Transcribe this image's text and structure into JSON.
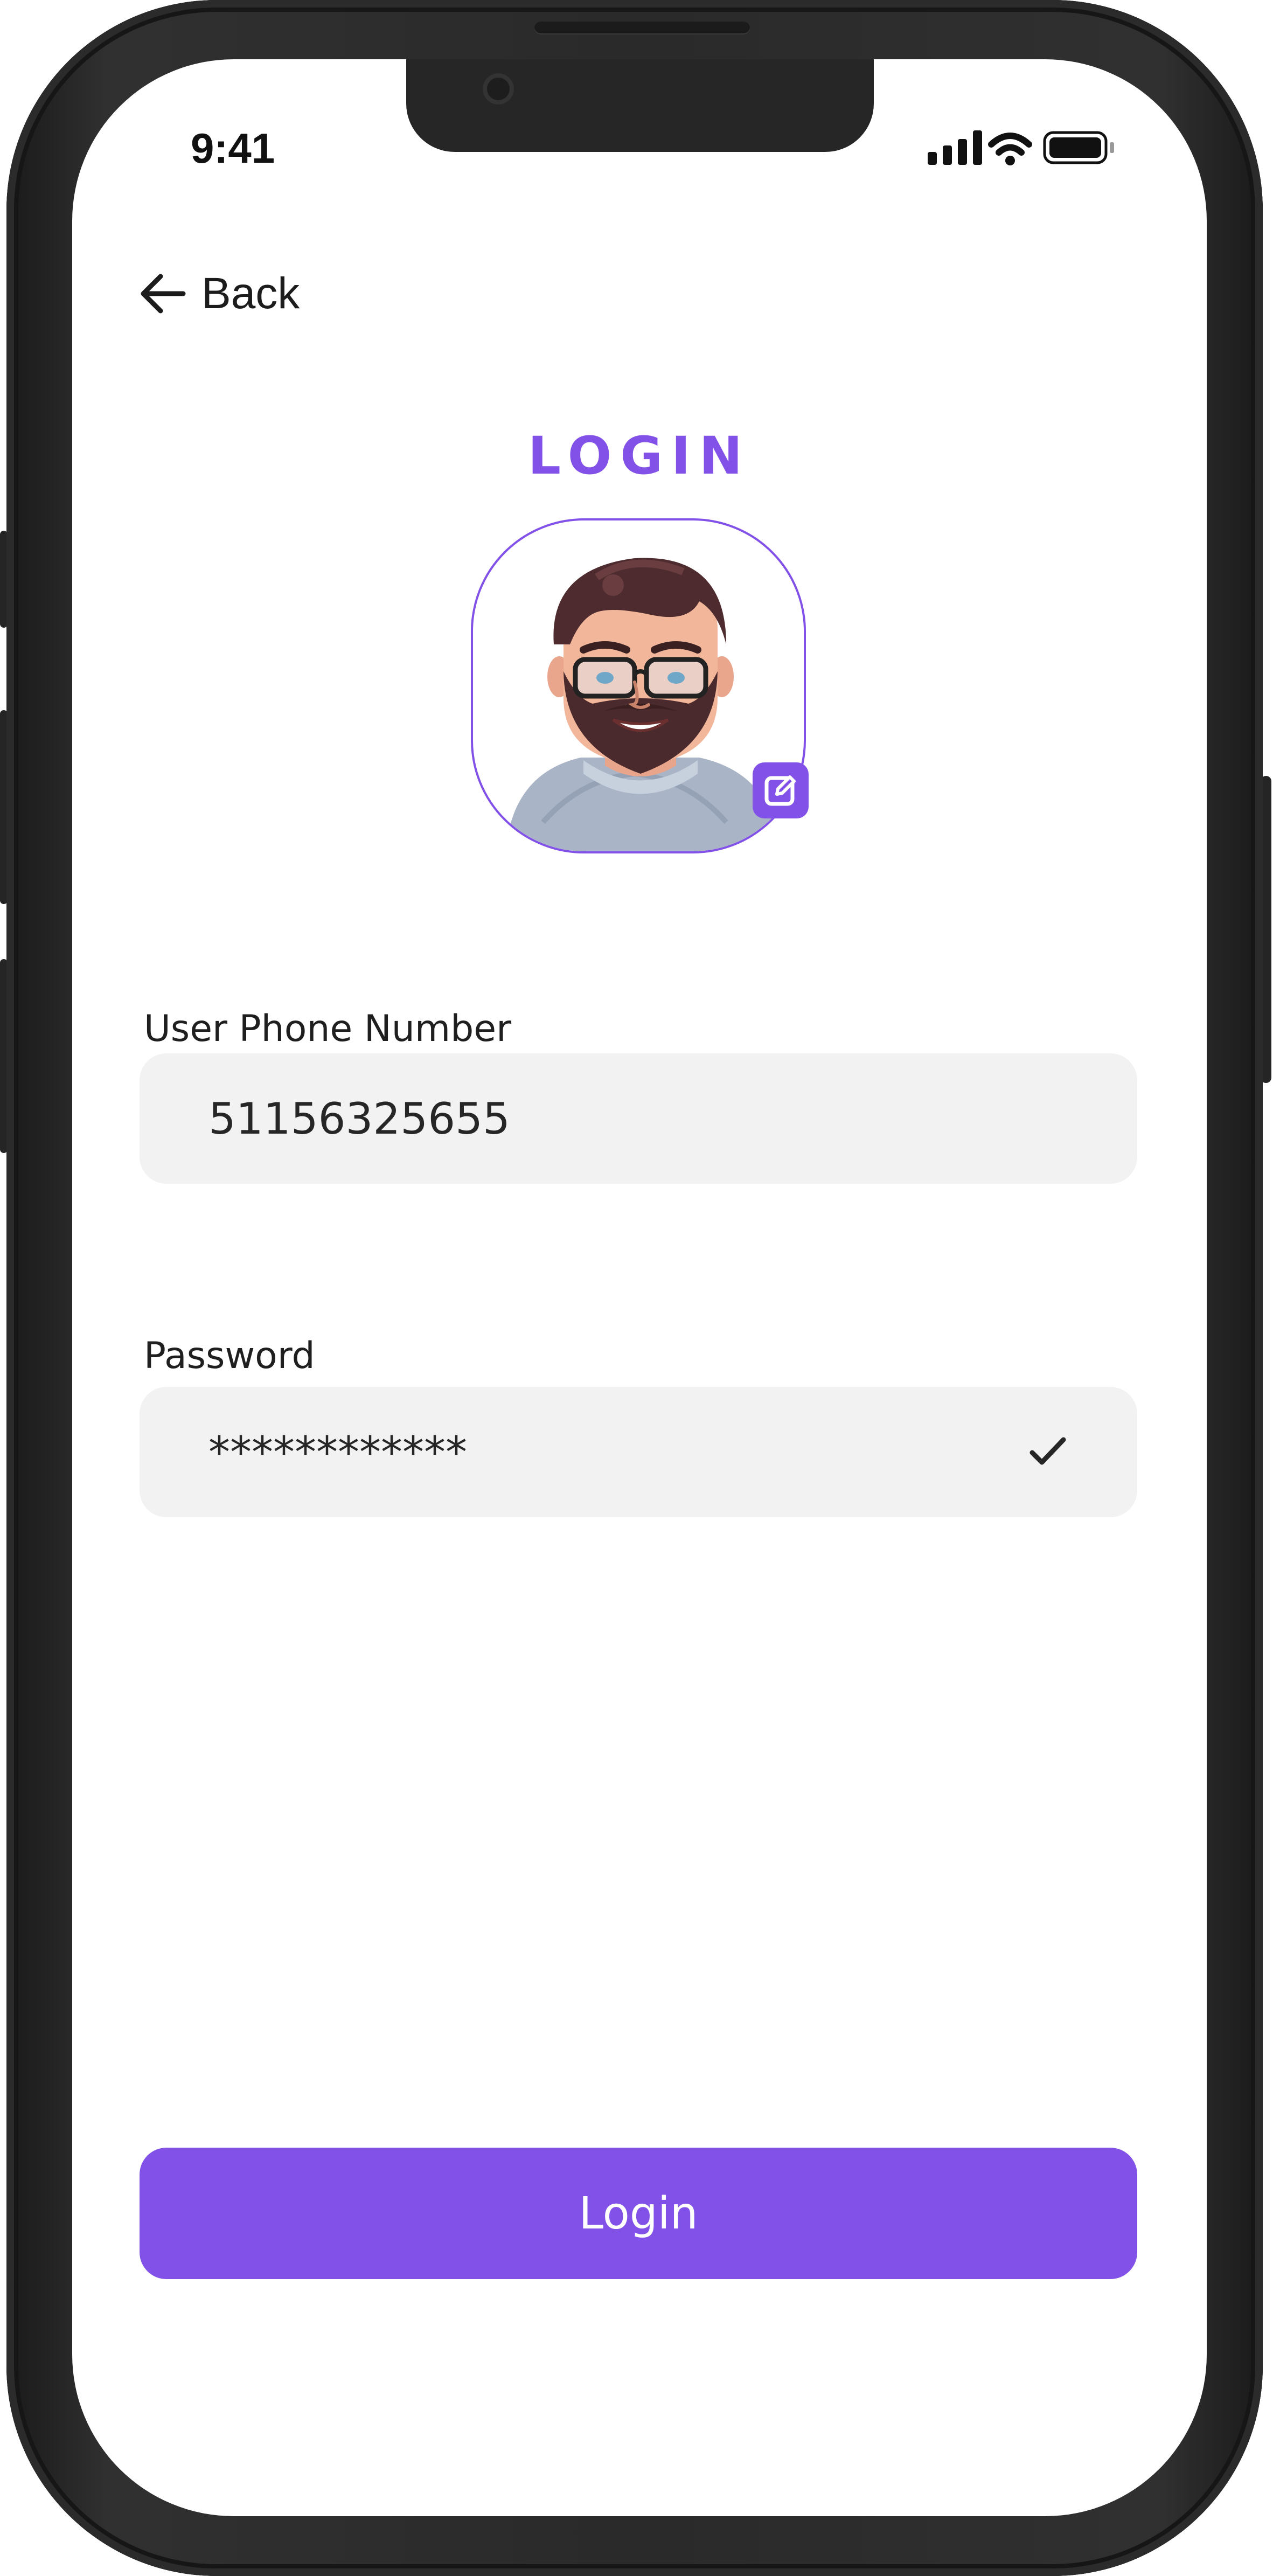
{
  "status_bar": {
    "time": "9:41"
  },
  "nav": {
    "back_label": "Back",
    "back_icon": "arrow-left-icon"
  },
  "page": {
    "title": "LOGIN"
  },
  "avatar": {
    "edit_icon": "edit-icon"
  },
  "form": {
    "phone": {
      "label": "User Phone Number",
      "value": "51156325655"
    },
    "password": {
      "label": "Password",
      "value": "************",
      "status_icon": "check-icon"
    }
  },
  "actions": {
    "login_label": "Login"
  },
  "colors": {
    "accent": "#8151e8",
    "field_bg": "#f2f2f2",
    "frame": "#2a2a2a"
  }
}
